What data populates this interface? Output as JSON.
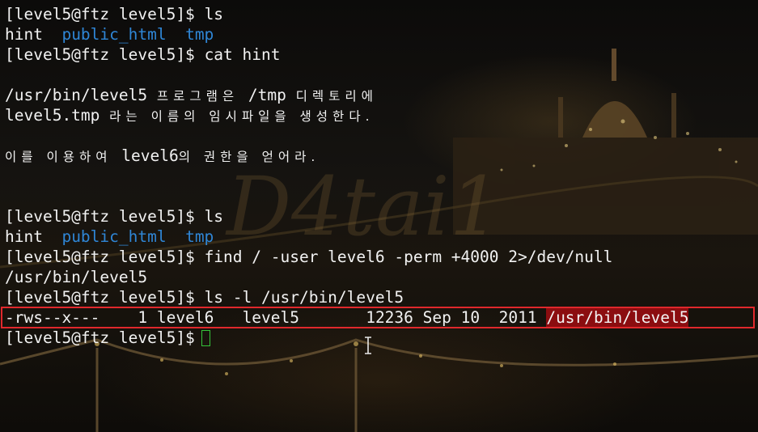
{
  "terminal": {
    "lines": [
      {
        "prompt": "[level5@ftz level5]$",
        "command": "ls"
      },
      {
        "items": [
          "hint",
          "public_html",
          "tmp"
        ]
      },
      {
        "prompt": "[level5@ftz level5]$",
        "command": "cat hint"
      },
      {
        "text": ""
      },
      {
        "a": "/usr/bin/level5",
        "b": "프로그램은",
        "c": "/tmp",
        "d": "디렉토리에"
      },
      {
        "a": "level5.tmp",
        "b": "라는 이름의 임시파일을 생성한다."
      },
      {
        "text": ""
      },
      {
        "a": "이를 이용하여",
        "b": "level6",
        "c": "의 권한을 얻어라."
      },
      {
        "text": ""
      },
      {
        "text": ""
      },
      {
        "prompt": "[level5@ftz level5]$",
        "command": "ls"
      },
      {
        "items": [
          "hint",
          "public_html",
          "tmp"
        ]
      },
      {
        "prompt": "[level5@ftz level5]$",
        "command": "find / -user level6 -perm +4000 2>/dev/null"
      },
      {
        "text": "/usr/bin/level5"
      },
      {
        "prompt": "[level5@ftz level5]$",
        "command": "ls -l /usr/bin/level5"
      },
      {
        "perms": "-rws--x---",
        "links": "1",
        "owner": "level6",
        "group": "level5",
        "size": "12236",
        "month": "Sep",
        "day": "10",
        "year": "2011",
        "path": "/usr/bin/level5"
      },
      {
        "prompt": "[level5@ftz level5]$"
      }
    ],
    "watermark": "D4tai1"
  },
  "colors": {
    "text": "#f2f2f2",
    "directory": "#2f86d6",
    "highlight_box": "#e0282c",
    "highlight_fill": "#8b0d10",
    "cursor": "#35c43a"
  },
  "icons": {
    "cursor": "text-cursor-block",
    "mouse": "i-beam-cursor-icon"
  }
}
